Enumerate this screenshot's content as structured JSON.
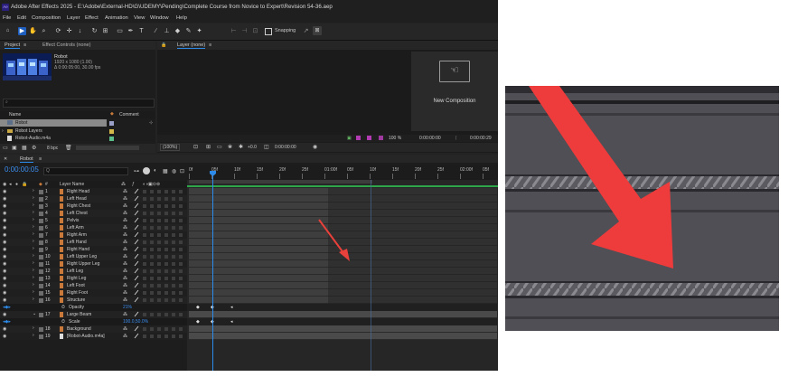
{
  "window": {
    "app_icon": "Ae",
    "title": "Adobe After Effects 2025 - E:\\Adobe\\External-HD\\G\\UDEMY\\Pending\\Complete Course from Novice to Expert\\Revision 54-36.aep"
  },
  "menu": [
    "File",
    "Edit",
    "Composition",
    "Layer",
    "Effect",
    "Animation",
    "View",
    "Window",
    "Help"
  ],
  "toolbar": {
    "snapping_label": "Snapping"
  },
  "project_panel": {
    "tab_project": "Project",
    "tab_effect_controls": "Effect Controls (none)",
    "item_name": "Robot",
    "item_resolution": "1920 x 1080 (1.00)",
    "item_duration": "Δ 0:00:05:00, 30.00 fps",
    "col_name": "Name",
    "col_comment": "Comment",
    "items": [
      "Robot",
      "Robot Layers",
      "Robot-Audio.m4a"
    ],
    "bpc": "8 bpc"
  },
  "viewer": {
    "tab_layer": "Layer (none)",
    "new_composition": "New Composition",
    "zoom_pct": "100 %",
    "time_a": "0:00:00:00",
    "time_b": "0:00:00:29",
    "bottom_zoom": "(100%)",
    "bottom_val": "+0.0",
    "bottom_time": "0:00:00:00"
  },
  "timeline": {
    "tab_name": "Robot",
    "current_time": "0:00:00:05",
    "search_placeholder": "Q",
    "col_layer_name": "Layer Name",
    "ruler": [
      "0f",
      "05f",
      "10f",
      "15f",
      "20f",
      "25f",
      "01:00f",
      "05f",
      "10f",
      "15f",
      "20f",
      "25f",
      "02:00f",
      "05f"
    ],
    "layers": [
      {
        "num": "1",
        "name": "Right Head"
      },
      {
        "num": "2",
        "name": "Left Head"
      },
      {
        "num": "3",
        "name": "Right Chest"
      },
      {
        "num": "4",
        "name": "Left Chest"
      },
      {
        "num": "5",
        "name": "Pelvis"
      },
      {
        "num": "6",
        "name": "Left Arm"
      },
      {
        "num": "7",
        "name": "Right Arm"
      },
      {
        "num": "8",
        "name": "Left Hand"
      },
      {
        "num": "9",
        "name": "Right Hand"
      },
      {
        "num": "10",
        "name": "Left Upper Leg"
      },
      {
        "num": "11",
        "name": "Right Upper Leg"
      },
      {
        "num": "12",
        "name": "Left Leg"
      },
      {
        "num": "13",
        "name": "Right Leg"
      },
      {
        "num": "14",
        "name": "Left Foot"
      },
      {
        "num": "15",
        "name": "Right Foot"
      },
      {
        "num": "16",
        "name": "Structure"
      }
    ],
    "opacity_label": "Opacity",
    "opacity_value": "21%",
    "layer17": {
      "num": "17",
      "name": "Large Beam"
    },
    "scale_label": "Scale",
    "scale_value": "100.0,50.0%",
    "layer18": {
      "num": "18",
      "name": "Background"
    },
    "layer19": {
      "num": "19",
      "name": "[Robot-Audio.m4a]"
    }
  },
  "colors": {
    "accent": "#2d8ceb",
    "arrow": "#e8403a",
    "label_orange": "#c97a3a"
  }
}
